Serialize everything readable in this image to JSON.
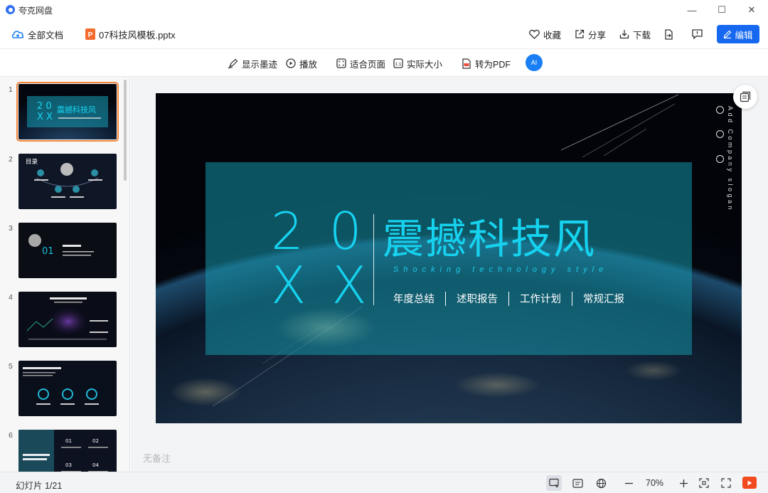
{
  "app": {
    "title": "夸克网盘"
  },
  "window_controls": {
    "minimize": "—",
    "maximize": "☐",
    "close": "✕"
  },
  "header": {
    "all_docs": "全部文档",
    "file_name": "07科技风模板.pptx",
    "actions": {
      "favorite": "收藏",
      "share": "分享",
      "download": "下载",
      "edit": "编辑"
    }
  },
  "toolbar": {
    "show_ink": "显示墨迹",
    "play": "播放",
    "fit_page": "适合页面",
    "actual_size": "实际大小",
    "to_pdf": "转为PDF",
    "ai_badge": "AI"
  },
  "thumbnails": [
    {
      "num": "1",
      "selected": true
    },
    {
      "num": "2",
      "selected": false
    },
    {
      "num": "3",
      "selected": false
    },
    {
      "num": "4",
      "selected": false
    },
    {
      "num": "5",
      "selected": false
    },
    {
      "num": "6",
      "selected": false
    }
  ],
  "slide": {
    "year_top": "20",
    "year_bottom": "XX",
    "title": "震撼科技风",
    "subtitle": "Shocking technology style",
    "items": [
      "年度总结",
      "述职报告",
      "工作计划",
      "常规汇报"
    ],
    "slogan": "Add Company slogan"
  },
  "notes_placeholder": "无备注",
  "status": {
    "slide_indicator": "幻灯片 1/21",
    "zoom": "70%"
  },
  "colors": {
    "accent": "#1668f0",
    "slide_cyan": "#16d2ef",
    "selected_outline": "#f5853a",
    "play_orange": "#f04a1e"
  }
}
